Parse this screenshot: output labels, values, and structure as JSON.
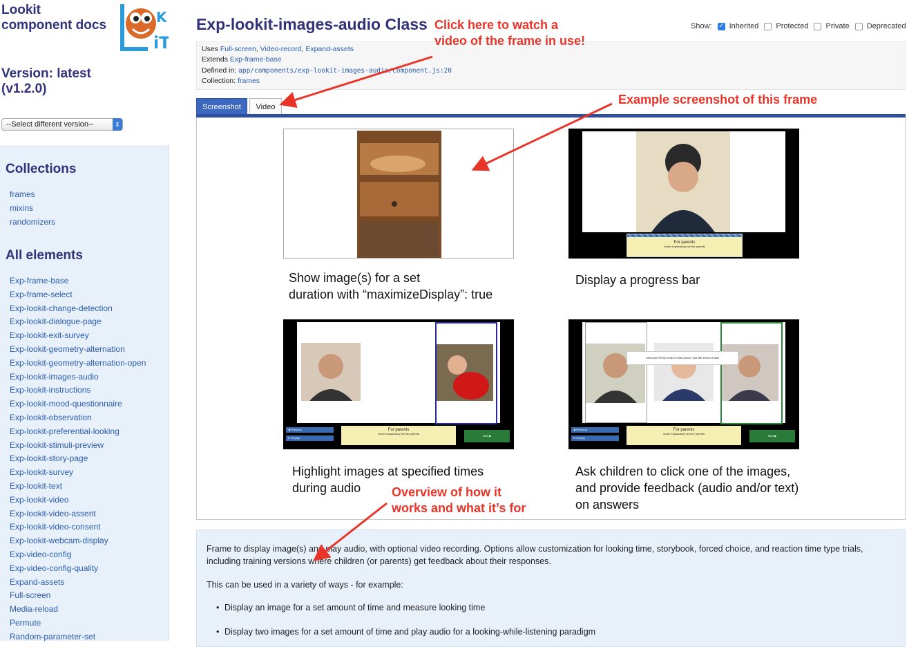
{
  "sidebar": {
    "brand": "Lookit component docs",
    "logo_text": "LOOKIT",
    "version_label": "Version: latest (v1.2.0)",
    "version_select": "--Select different version--",
    "collections_heading": "Collections",
    "collections": [
      "frames",
      "mixins",
      "randomizers"
    ],
    "elements_heading": "All elements",
    "elements": [
      "Exp-frame-base",
      "Exp-frame-select",
      "Exp-lookit-change-detection",
      "Exp-lookit-dialogue-page",
      "Exp-lookit-exit-survey",
      "Exp-lookit-geometry-alternation",
      "Exp-lookit-geometry-alternation-open",
      "Exp-lookit-images-audio",
      "Exp-lookit-instructions",
      "Exp-lookit-mood-questionnaire",
      "Exp-lookit-observation",
      "Exp-lookit-preferential-looking",
      "Exp-lookit-stimuli-preview",
      "Exp-lookit-story-page",
      "Exp-lookit-survey",
      "Exp-lookit-text",
      "Exp-lookit-video",
      "Exp-lookit-video-assent",
      "Exp-lookit-video-consent",
      "Exp-lookit-webcam-display",
      "Exp-video-config",
      "Exp-video-config-quality",
      "Expand-assets",
      "Full-screen",
      "Media-reload",
      "Permute",
      "Random-parameter-set"
    ]
  },
  "header": {
    "title": "Exp-lookit-images-audio Class",
    "show_label": "Show:",
    "filters": [
      {
        "label": "Inherited",
        "checked": true
      },
      {
        "label": "Protected",
        "checked": false
      },
      {
        "label": "Private",
        "checked": false
      },
      {
        "label": "Deprecated",
        "checked": false
      }
    ]
  },
  "meta": {
    "uses_label": "Uses",
    "uses": [
      "Full-screen",
      "Video-record",
      "Expand-assets"
    ],
    "extends_label": "Extends",
    "extends": "Exp-frame-base",
    "defined_label": "Defined in:",
    "defined_in": "app/components/exp-lookit-images-audio/component.js:20",
    "collection_label": "Collection:",
    "collection": "frames"
  },
  "tabs": {
    "screenshot": "Screenshot",
    "video": "Video"
  },
  "screenshot": {
    "captions": [
      [
        "Show image(s) for a set",
        "duration with “maximizeDisplay”: true"
      ],
      [
        "Display a progress bar"
      ],
      [
        "Highlight images at specified times",
        "during audio"
      ],
      [
        "Ask children to click one of the images,",
        "and provide feedback (audio and/or text)",
        "on answers"
      ]
    ],
    "for_parents": "For parents",
    "parents_sub": "Some explanatory text for parents",
    "feedback_text": "Great job! Remy is sad in that picture, just like Zenna is sad!",
    "prev_button": "◀ Previous",
    "replay_button": "⟳ Replay",
    "next_button": "Next ▶"
  },
  "overview": {
    "para1": "Frame to display image(s) and play audio, with optional video recording. Options allow customization for looking time, storybook, forced choice, and reaction time type trials, including training versions where children (or parents) get feedback about their responses.",
    "para2": "This can be used in a variety of ways - for example:",
    "bullets": [
      "Display an image for a set amount of time and measure looking time",
      "Display two images for a set amount of time and play audio for a looking-while-listening paradigm"
    ]
  },
  "annotations": {
    "video": [
      "Click here to watch a",
      "video of the frame in use!"
    ],
    "screenshot": "Example screenshot of this frame",
    "overview": [
      "Overview of how it",
      "works and what it’s for"
    ]
  },
  "colors": {
    "annotation": "#e8352a",
    "heading": "#32327a",
    "link": "#2a5db0",
    "tab_active": "#3d68c0"
  }
}
